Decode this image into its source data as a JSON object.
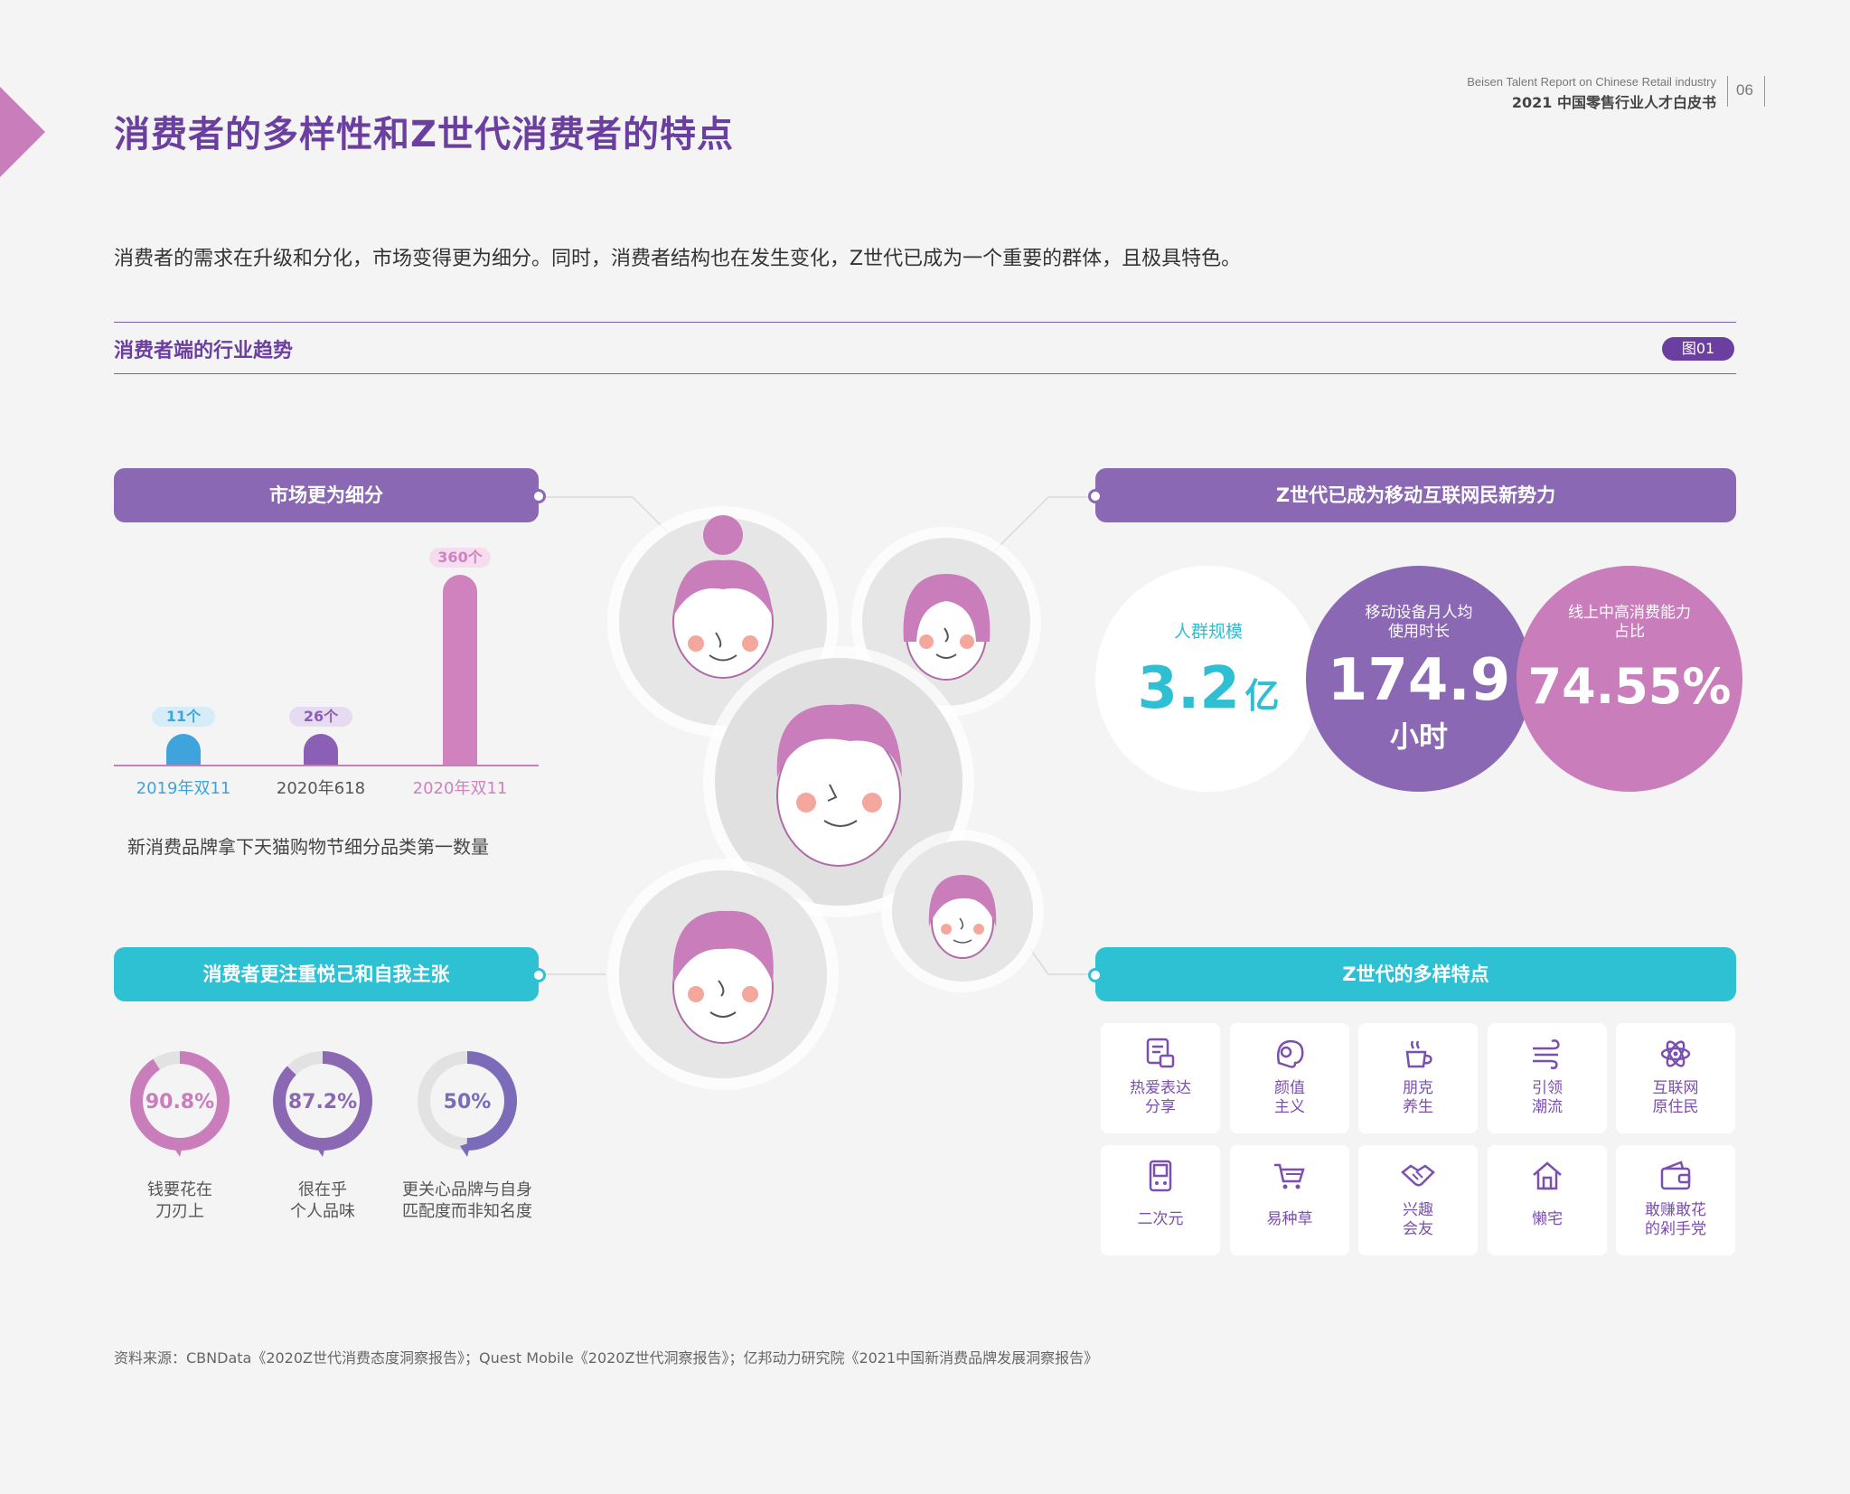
{
  "header": {
    "report_en": "Beisen Talent Report on Chinese Retail industry",
    "report_cn": "2021 中国零售行业人才白皮书",
    "page_number": "06"
  },
  "title": "消费者的多样性和Z世代消费者的特点",
  "intro": "消费者的需求在升级和分化，市场变得更为细分。同时，消费者结构也在发生变化，Z世代已成为一个重要的群体，且极具特色。",
  "section": {
    "label": "消费者端的行业趋势",
    "figure_tag": "图01"
  },
  "market_panel": {
    "title": "市场更为细分",
    "caption": "新消费品牌拿下天猫购物节细分品类第一数量",
    "bar_labels": [
      "11个",
      "26个",
      "360个"
    ]
  },
  "chart_data": {
    "type": "bar",
    "categories": [
      "2019年双11",
      "2020年618",
      "2020年双11"
    ],
    "values": [
      11,
      26,
      360
    ],
    "colors": [
      "#3fa3dc",
      "#8a5fb5",
      "#cf82bd"
    ]
  },
  "self_panel": {
    "title": "消费者更注重悦己和自我主张",
    "donuts": [
      {
        "value": 90.8,
        "label_value": "90.8%",
        "line1": "钱要花在",
        "line2": "刀刃上",
        "color": "#c97dbb"
      },
      {
        "value": 87.2,
        "label_value": "87.2%",
        "line1": "很在乎",
        "line2": "个人品味",
        "color": "#8a68b4"
      },
      {
        "value": 50,
        "label_value": "50%",
        "line1": "更关心品牌与自身",
        "line2": "匹配度而非知名度",
        "color": "#7b6bb8"
      }
    ]
  },
  "genz_panel": {
    "title": "Z世代已成为移动互联网民新势力",
    "stats": [
      {
        "label": "人群规模",
        "value": "3.2",
        "unit": "亿"
      },
      {
        "label_line1": "移动设备月人均",
        "label_line2": "使用时长",
        "value": "174.9",
        "unit": "小时"
      },
      {
        "label_line1": "线上中高消费能力",
        "label_line2": "占比",
        "value": "74.55%"
      }
    ]
  },
  "traits_panel": {
    "title": "Z世代的多样特点",
    "items": [
      {
        "icon": "chat-icon",
        "line1": "热爱表达",
        "line2": "分享"
      },
      {
        "icon": "face-icon",
        "line1": "颜值",
        "line2": "主义"
      },
      {
        "icon": "tea-cup-icon",
        "line1": "朋克",
        "line2": "养生"
      },
      {
        "icon": "wind-icon",
        "line1": "引领",
        "line2": "潮流"
      },
      {
        "icon": "atom-icon",
        "line1": "互联网",
        "line2": "原住民"
      },
      {
        "icon": "game-console-icon",
        "line1": "二次元",
        "line2": ""
      },
      {
        "icon": "shopping-cart-icon",
        "line1": "易种草",
        "line2": ""
      },
      {
        "icon": "handshake-icon",
        "line1": "兴趣",
        "line2": "会友"
      },
      {
        "icon": "home-icon",
        "line1": "懒宅",
        "line2": ""
      },
      {
        "icon": "wallet-icon",
        "line1": "敢赚敢花",
        "line2": "的剁手党"
      }
    ]
  },
  "source": "资料来源：CBNData《2020Z世代消费态度洞察报告》；Quest Mobile《2020Z世代洞察报告》；亿邦动力研究院《2021中国新消费品牌发展洞察报告》"
}
